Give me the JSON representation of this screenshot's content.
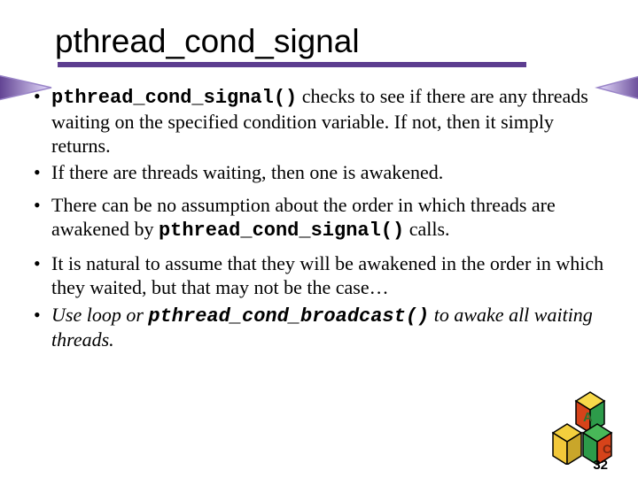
{
  "title": "pthread_cond_signal",
  "bullets": {
    "b1": {
      "code": "pthread_cond_signal()",
      "rest": " checks to see if there are any threads waiting on the specified condition variable. If not, then it simply returns."
    },
    "b2": "If there are threads waiting, then one is awakened.",
    "b3": {
      "pre": "There can be no assumption about the order in which threads are awakened by ",
      "code": "pthread_cond_signal()",
      "post": " calls."
    },
    "b4": "It is natural to assume that they will be awakened in the order in which they waited, but that may not be the case…",
    "b5": {
      "pre": "Use loop or ",
      "code": "pthread_cond_broadcast()",
      "post": " to awake all waiting threads."
    }
  },
  "page_number": "32"
}
